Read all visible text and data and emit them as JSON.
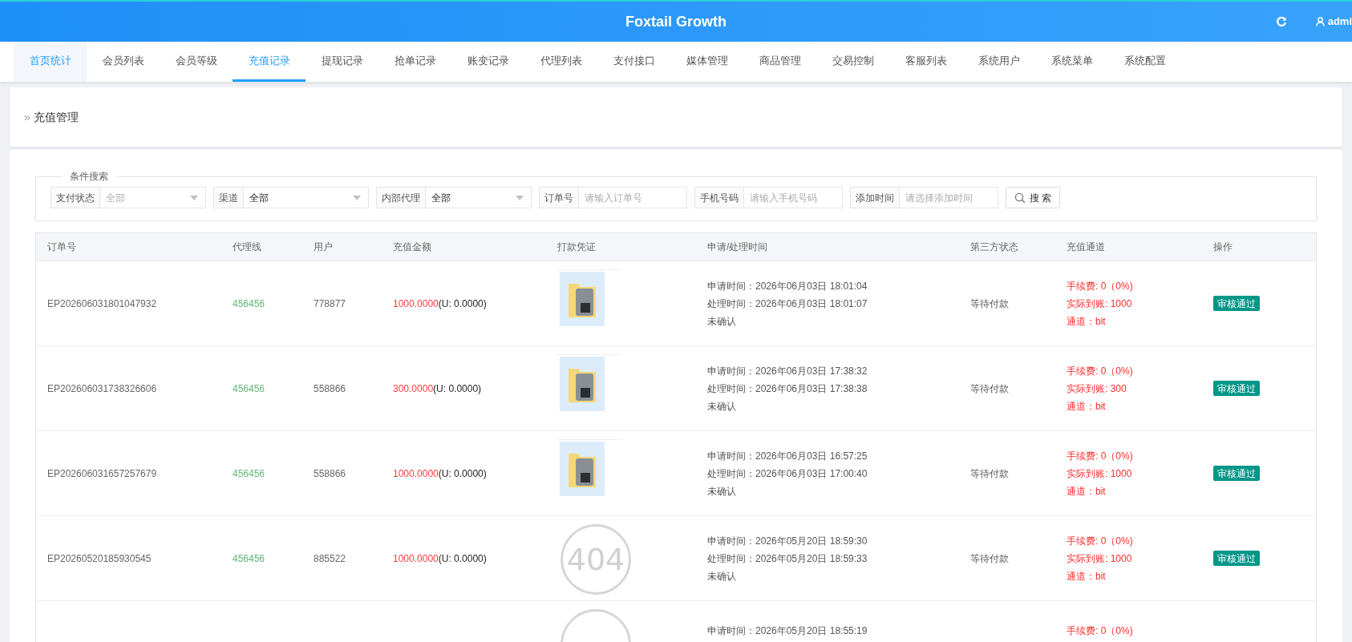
{
  "header": {
    "title": "Foxtail Growth",
    "user": "admi"
  },
  "tabs": [
    {
      "label": "首页统计",
      "selected": false,
      "hovered": true
    },
    {
      "label": "会员列表",
      "selected": false,
      "hovered": false
    },
    {
      "label": "会员等级",
      "selected": false,
      "hovered": false
    },
    {
      "label": "充值记录",
      "selected": true,
      "hovered": false
    },
    {
      "label": "提现记录",
      "selected": false,
      "hovered": false
    },
    {
      "label": "抢单记录",
      "selected": false,
      "hovered": false
    },
    {
      "label": "账变记录",
      "selected": false,
      "hovered": false
    },
    {
      "label": "代理列表",
      "selected": false,
      "hovered": false
    },
    {
      "label": "支付接口",
      "selected": false,
      "hovered": false
    },
    {
      "label": "媒体管理",
      "selected": false,
      "hovered": false
    },
    {
      "label": "商品管理",
      "selected": false,
      "hovered": false
    },
    {
      "label": "交易控制",
      "selected": false,
      "hovered": false
    },
    {
      "label": "客服列表",
      "selected": false,
      "hovered": false
    },
    {
      "label": "系统用户",
      "selected": false,
      "hovered": false
    },
    {
      "label": "系统菜单",
      "selected": false,
      "hovered": false
    },
    {
      "label": "系统配置",
      "selected": false,
      "hovered": false
    }
  ],
  "breadcrumb": {
    "marker": "»",
    "title": "充值管理"
  },
  "search": {
    "legend": "条件搜索",
    "filters": [
      {
        "kind": "select",
        "label": "支付状态",
        "placeholder": "全部"
      },
      {
        "kind": "select",
        "label": "渠道",
        "value": "全部"
      },
      {
        "kind": "select",
        "label": "内部代理",
        "value": "全部"
      },
      {
        "kind": "input",
        "label": "订单号",
        "placeholder": "请输入订单号"
      },
      {
        "kind": "input",
        "label": "手机号码",
        "placeholder": "请输入手机号码"
      },
      {
        "kind": "input",
        "label": "添加时间",
        "placeholder": "请选择添加时间"
      }
    ],
    "button": "搜 索"
  },
  "table": {
    "columns": [
      "订单号",
      "代理线",
      "用户",
      "充值金额",
      "打款凭证",
      "申请/处理时间",
      "第三方状态",
      "充值通道",
      "操作"
    ],
    "rows": [
      {
        "order_no": "EP202606031801047932",
        "agent": "456456",
        "user": "778877",
        "amount": "1000.0000",
        "amount_u": "(U: 0.0000)",
        "voucher": {
          "kind": "image"
        },
        "apply_time": "申请时间：2026年06月03日 18:01:04",
        "process_time": "处理时间：2026年06月03日 18:01:07",
        "confirm": "未确认",
        "third_status": "等待付款",
        "fee": "手续费: 0（0%)",
        "actual": "实际到账: 1000",
        "channel": "通道：bit",
        "action": "审核通过"
      },
      {
        "order_no": "EP202606031738326606",
        "agent": "456456",
        "user": "558866",
        "amount": "300.0000",
        "amount_u": "(U: 0.0000)",
        "voucher": {
          "kind": "image"
        },
        "apply_time": "申请时间：2026年06月03日 17:38:32",
        "process_time": "处理时间：2026年06月03日 17:38:38",
        "confirm": "未确认",
        "third_status": "等待付款",
        "fee": "手续费: 0（0%)",
        "actual": "实际到账: 300",
        "channel": "通道：bit",
        "action": "审核通过"
      },
      {
        "order_no": "EP202606031657257679",
        "agent": "456456",
        "user": "558866",
        "amount": "1000.0000",
        "amount_u": "(U: 0.0000)",
        "voucher": {
          "kind": "image"
        },
        "apply_time": "申请时间：2026年06月03日 16:57:25",
        "process_time": "处理时间：2026年06月03日 17:00:40",
        "confirm": "未确认",
        "third_status": "等待付款",
        "fee": "手续费: 0（0%)",
        "actual": "实际到账: 1000",
        "channel": "通道：bit",
        "action": "审核通过"
      },
      {
        "order_no": "EP20260520185930545",
        "agent": "456456",
        "user": "885522",
        "amount": "1000.0000",
        "amount_u": "(U: 0.0000)",
        "voucher": {
          "kind": "missing",
          "text": "404"
        },
        "apply_time": "申请时间：2026年05月20日 18:59:30",
        "process_time": "处理时间：2026年05月20日 18:59:33",
        "confirm": "未确认",
        "third_status": "等待付款",
        "fee": "手续费: 0（0%)",
        "actual": "实际到账: 1000",
        "channel": "通道：bit",
        "action": "审核通过"
      },
      {
        "voucher": {
          "kind": "missing"
        },
        "apply_time": "申请时间：2026年05月20日 18:55:19",
        "fee": "手续费: 0（0%)"
      }
    ]
  }
}
